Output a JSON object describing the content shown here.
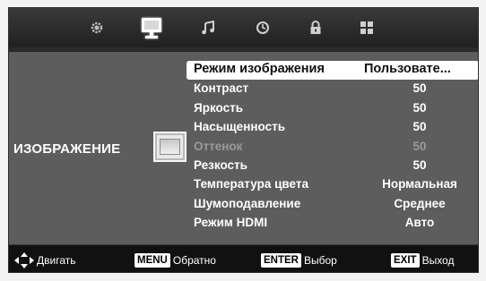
{
  "tabs": [
    {
      "icon": "gear-icon",
      "active": false
    },
    {
      "icon": "monitor-icon",
      "active": true
    },
    {
      "icon": "music-note-icon",
      "active": false
    },
    {
      "icon": "clock-icon",
      "active": false
    },
    {
      "icon": "lock-icon",
      "active": false
    },
    {
      "icon": "grid-icon",
      "active": false
    }
  ],
  "category": {
    "label": "ИЗОБРАЖЕНИЕ",
    "icon": "picture-icon"
  },
  "settings": [
    {
      "label": "Режим изображения",
      "value": "Пользовате...",
      "state": "selected"
    },
    {
      "label": "Контраст",
      "value": "50",
      "state": "normal"
    },
    {
      "label": "Яркость",
      "value": "50",
      "state": "normal"
    },
    {
      "label": "Насыщенность",
      "value": "50",
      "state": "normal"
    },
    {
      "label": "Оттенок",
      "value": "50",
      "state": "disabled"
    },
    {
      "label": "Резкость",
      "value": "50",
      "state": "normal"
    },
    {
      "label": "Температура цвета",
      "value": "Нормальная",
      "state": "normal"
    },
    {
      "label": "Шумоподавление",
      "value": "Среднее",
      "state": "normal"
    },
    {
      "label": "Режим HDMI",
      "value": "Авто",
      "state": "normal"
    }
  ],
  "hints": {
    "move": {
      "icon": "arrows-icon",
      "label": "Двигать"
    },
    "menu": {
      "key": "MENU",
      "label": "Обратно"
    },
    "enter": {
      "key": "ENTER",
      "label": "Выбор"
    },
    "exit": {
      "key": "EXIT",
      "label": "Выход"
    }
  },
  "colors": {
    "panel": "#5d5d5d",
    "topbar": "#202020",
    "bottombar": "#111111",
    "selected": "#ffffff",
    "disabled": "#9a9a9a"
  }
}
